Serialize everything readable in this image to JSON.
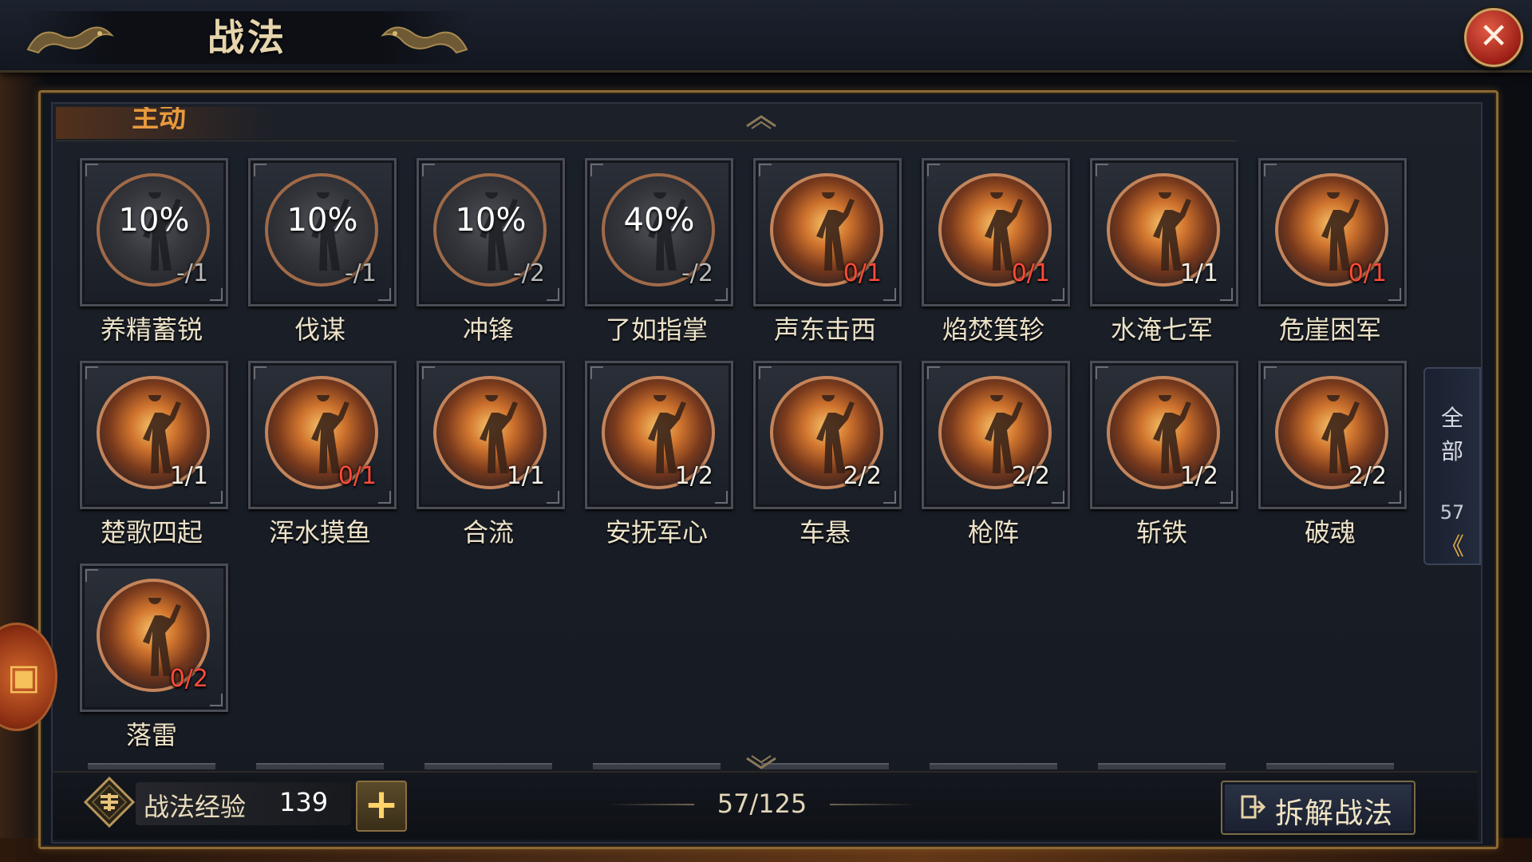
{
  "header": {
    "title": "战法",
    "close_icon": "close-x"
  },
  "section": {
    "label": "主动"
  },
  "skills": [
    {
      "name": "养精蓄锐",
      "percent": "10%",
      "count": "-/1",
      "state": "fragment"
    },
    {
      "name": "伐谋",
      "percent": "10%",
      "count": "-/1",
      "state": "fragment"
    },
    {
      "name": "冲锋",
      "percent": "10%",
      "count": "-/2",
      "state": "fragment"
    },
    {
      "name": "了如指掌",
      "percent": "40%",
      "count": "-/2",
      "state": "fragment"
    },
    {
      "name": "声东击西",
      "percent": "",
      "count": "0/1",
      "state": "empty"
    },
    {
      "name": "焰焚箕轸",
      "percent": "",
      "count": "0/1",
      "state": "empty"
    },
    {
      "name": "水淹七军",
      "percent": "",
      "count": "1/1",
      "state": "owned"
    },
    {
      "name": "危崖困军",
      "percent": "",
      "count": "0/1",
      "state": "empty"
    },
    {
      "name": "楚歌四起",
      "percent": "",
      "count": "1/1",
      "state": "owned"
    },
    {
      "name": "浑水摸鱼",
      "percent": "",
      "count": "0/1",
      "state": "empty"
    },
    {
      "name": "合流",
      "percent": "",
      "count": "1/1",
      "state": "owned"
    },
    {
      "name": "安抚军心",
      "percent": "",
      "count": "1/2",
      "state": "owned"
    },
    {
      "name": "车悬",
      "percent": "",
      "count": "2/2",
      "state": "owned"
    },
    {
      "name": "枪阵",
      "percent": "",
      "count": "2/2",
      "state": "owned"
    },
    {
      "name": "斩铁",
      "percent": "",
      "count": "1/2",
      "state": "owned"
    },
    {
      "name": "破魂",
      "percent": "",
      "count": "2/2",
      "state": "owned"
    },
    {
      "name": "落雷",
      "percent": "",
      "count": "0/2",
      "state": "empty"
    }
  ],
  "filter_tab": {
    "line1": "全",
    "line2": "部",
    "count": "57",
    "chevron": "《"
  },
  "footer": {
    "exp_label": "战法经验",
    "exp_value": "139",
    "plus_label": "+",
    "page_count": "57/125",
    "dismantle_label": "拆解战法"
  },
  "colors": {
    "accent_gold": "#8c6a34",
    "count_red": "#ff4a3a",
    "close_red": "#c0392b"
  }
}
